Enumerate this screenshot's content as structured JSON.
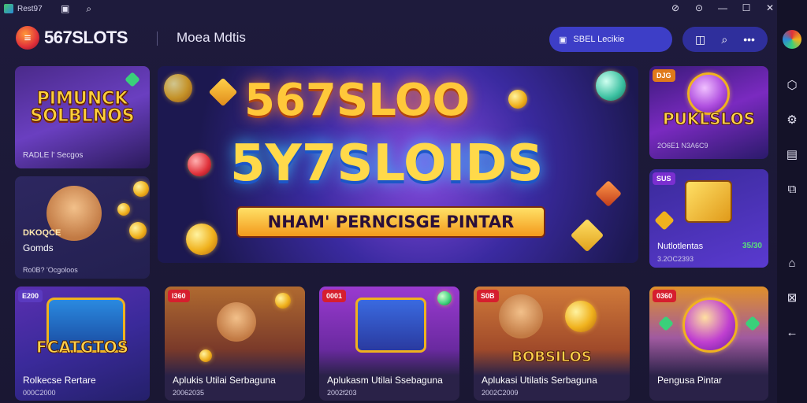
{
  "window": {
    "title": "Rest97"
  },
  "header": {
    "logo": "567SLOTS",
    "logo_mark": "≡",
    "nav_label": "Moea Mdtis",
    "search_label": "SBEL Lecikie",
    "search_icon": "search-icon",
    "icons": [
      "image-icon",
      "search-icon",
      "more-icon"
    ]
  },
  "hero": {
    "line1": "567SLOO",
    "line2": "5Y7SLOIDS",
    "banner": "NHAM' PERNCISGE PINTAR"
  },
  "left_cards": [
    {
      "art": "PIMUNCK SOLBLNOS",
      "label": "RADLE l' Secgos",
      "sub": ""
    },
    {
      "art": "DKOQCE",
      "label": "Gomds",
      "sub": "Ro0B? 'Ocgoloos"
    },
    {
      "art": "FCATGTOS",
      "label": "Rolkecse Rertare",
      "sub": "000C2000",
      "badge": "E200"
    }
  ],
  "right_cards": [
    {
      "art": "PUKLSLOS",
      "label": "",
      "sub": "2O6E1 N3A6C9",
      "badge": "DJG"
    },
    {
      "art": "",
      "label": "Nutlotlentas",
      "sub": "3.2OC2393",
      "badge": "SUS",
      "badge_right": "35/30"
    }
  ],
  "bottom_cards": [
    {
      "badge": "l360",
      "label": "Aplukis Utilai Serbaguna",
      "sub": "20062035"
    },
    {
      "badge": "0001",
      "label": "Aplukasm Utilai Ssebaguna",
      "sub": "2002f203"
    },
    {
      "badge": "S0B",
      "art": "BOBSILOS",
      "label": "Aplukasi Utilatis Serbaguna",
      "sub": "2002C2009"
    },
    {
      "badge": "0360",
      "label": "Pengusa Pintar",
      "sub": ""
    }
  ],
  "sidebar": [
    "app-icon",
    "puzzle-icon",
    "settings-icon",
    "folder-icon",
    "share-icon",
    "home-icon",
    "dismiss-icon",
    "back-icon"
  ],
  "colors": {
    "background": "#1e1b3c",
    "accent": "#3d3ec7",
    "gold": "#ffc83a",
    "badge": "#d61e2e"
  }
}
